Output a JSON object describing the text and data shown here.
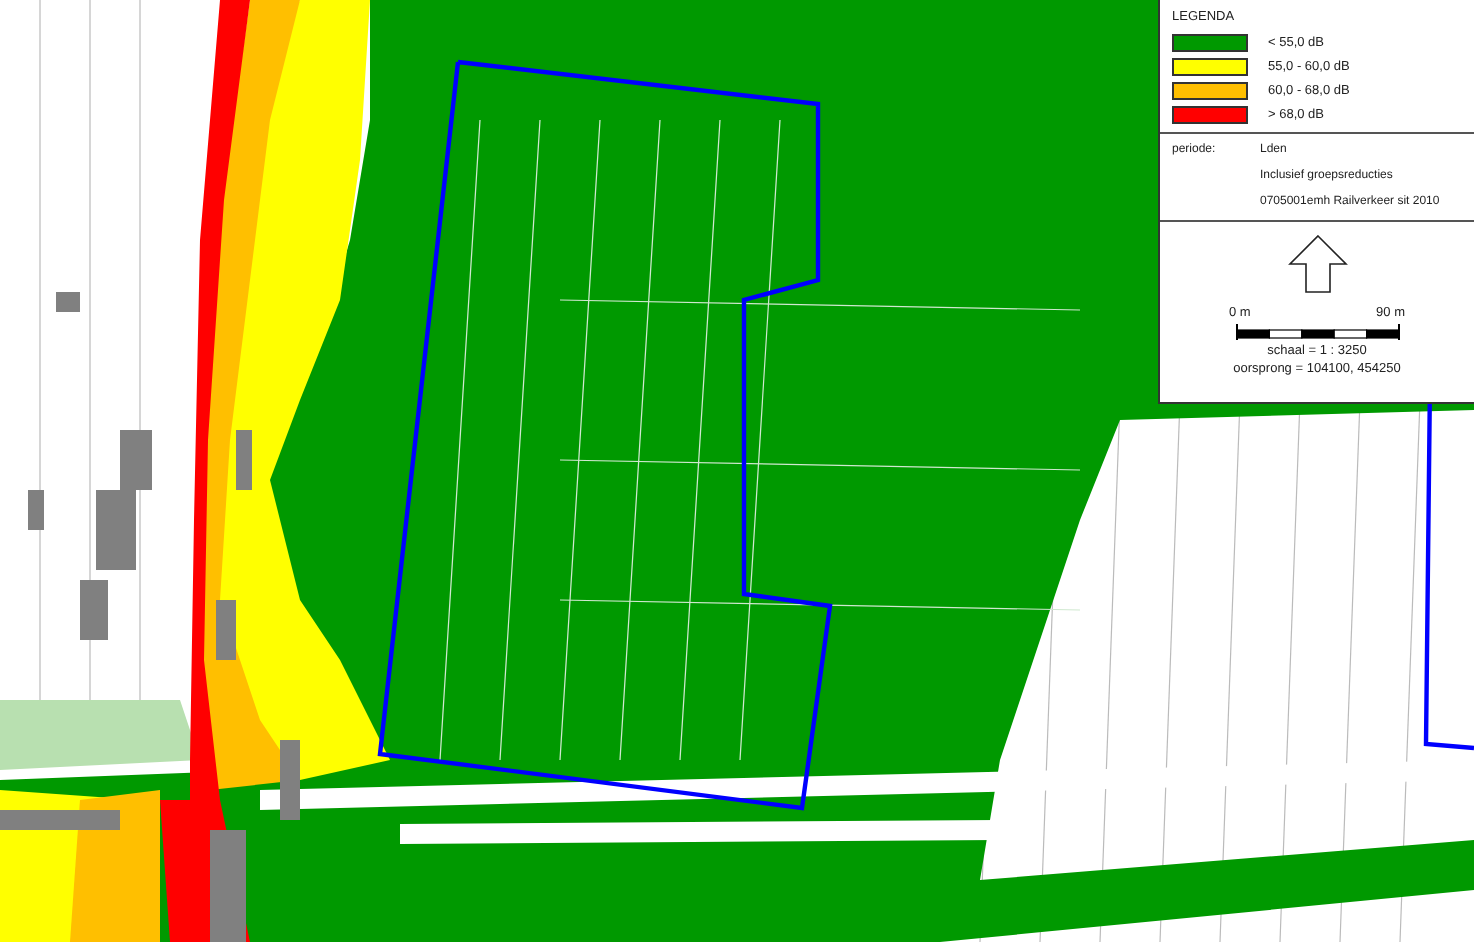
{
  "legend": {
    "title": "LEGENDA",
    "classes": [
      {
        "label": "< 55,0 dB",
        "color": "#009900"
      },
      {
        "label": "55,0 - 60,0 dB",
        "color": "#ffff00"
      },
      {
        "label": "60,0 - 68,0 dB",
        "color": "#ffbf00"
      },
      {
        "label": "> 68,0 dB",
        "color": "#ff0000"
      }
    ],
    "period_label": "periode:",
    "period_value": "Lden",
    "notes": [
      "Inclusief groepsreducties",
      "0705001emh Railverkeer sit 2010"
    ],
    "scale_bar": {
      "start": "0 m",
      "end": "90 m"
    },
    "scale": "schaal = 1 : 3250",
    "origin": "oorsprong = 104100, 454250"
  }
}
